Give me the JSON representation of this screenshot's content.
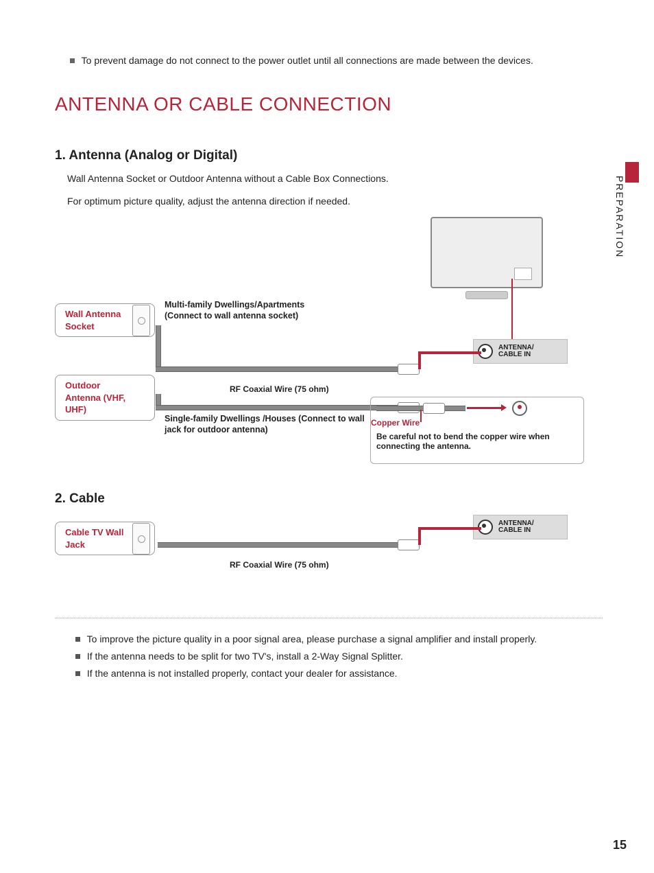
{
  "top_note": "To prevent damage do not connect to the power outlet until all connections are made between the devices.",
  "main_title": "ANTENNA OR CABLE CONNECTION",
  "side_tab": "PREPARATION",
  "page_number": "15",
  "section1": {
    "heading": "1. Antenna (Analog or Digital)",
    "intro1": "Wall Antenna Socket or Outdoor Antenna without a Cable Box Connections.",
    "intro2": "For optimum picture quality, adjust the antenna direction if needed.",
    "wall_socket_label": "Wall Antenna Socket",
    "outdoor_label": "Outdoor Antenna (VHF, UHF)",
    "multi_caption": "Multi-family Dwellings/Apartments (Connect to wall antenna socket)",
    "single_caption": "Single-family Dwellings /Houses (Connect to wall jack for outdoor antenna)",
    "rf_label": "RF Coaxial Wire (75 ohm)",
    "port_label_top": "ANTENNA/",
    "port_label_bottom": "CABLE IN",
    "copper_label": "Copper Wire",
    "warn_text": "Be careful not to bend the copper wire when connecting the antenna."
  },
  "section2": {
    "heading": "2. Cable",
    "cable_jack_label": "Cable TV Wall Jack",
    "rf_label": "RF Coaxial Wire (75 ohm)",
    "port_label_top": "ANTENNA/",
    "port_label_bottom": "CABLE IN"
  },
  "notes": [
    "To improve the picture quality in a poor signal area, please purchase a signal amplifier and install properly.",
    "If the antenna needs to be split for two TV's, install a 2-Way Signal Splitter.",
    "If the antenna is not installed properly, contact your dealer for assistance."
  ]
}
